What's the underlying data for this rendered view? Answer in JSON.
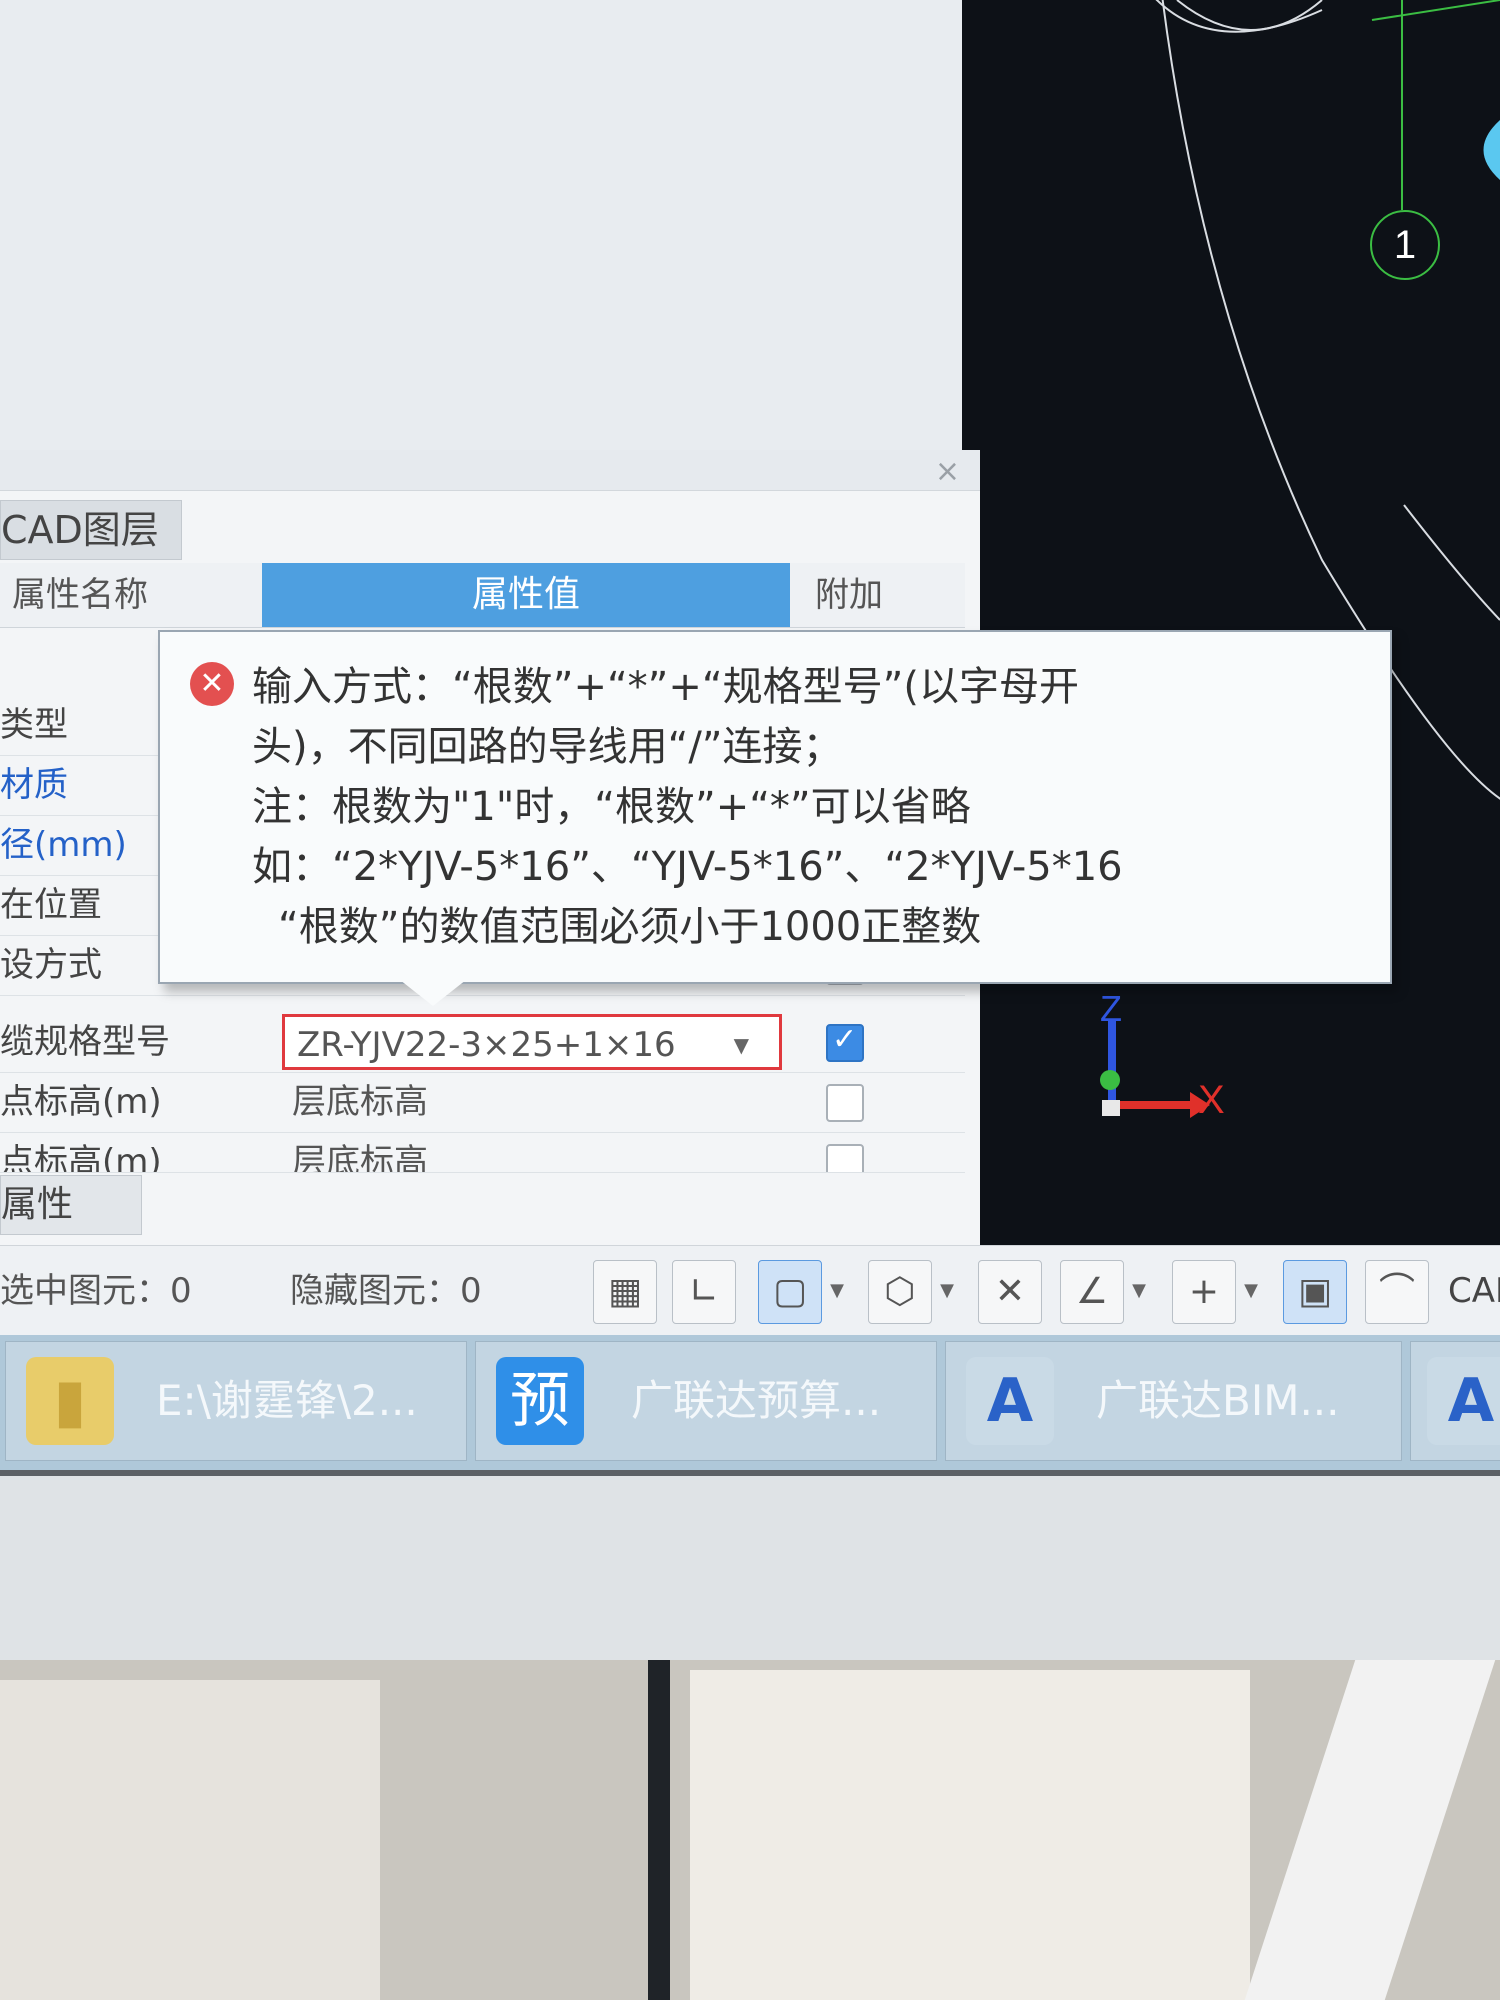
{
  "panel": {
    "close_glyph": "×",
    "tab_cad_layer": "CAD图层",
    "header": {
      "name": "属性名称",
      "value": "属性值",
      "extra": "附加"
    },
    "rows": [
      {
        "name": "类型",
        "value": ""
      },
      {
        "name": "材质",
        "value": ""
      },
      {
        "name": "径(mm)",
        "value": ""
      },
      {
        "name": "在位置",
        "value": ""
      },
      {
        "name": "设方式",
        "value": ""
      },
      {
        "name": "缆规格型号",
        "value": "ZR-YJV22-3×25+1×16"
      },
      {
        "name": "点标高(m)",
        "value": "层底标高"
      },
      {
        "name": "点标高(m)",
        "value": "层底标高"
      }
    ],
    "tab_props": "属性"
  },
  "tooltip": {
    "line1": "输入方式：“根数”+“*”+“规格型号”(以字母开",
    "line2": "头)，不同回路的导线用“/”连接；",
    "line3": "注：根数为\"1\"时，“根数”+“*”可以省略",
    "line4": "如：“2*YJV-5*16”、“YJV-5*16”、“2*YJV-5*16",
    "line5": "“根数”的数值范围必须小于1000正整数"
  },
  "status": {
    "selected": "选中图元：0",
    "hidden": "隐藏图元：0",
    "cad_label": "CAD"
  },
  "cad": {
    "axis_label": "1",
    "z_label": "Z",
    "x_label": "X"
  },
  "taskbar": [
    {
      "label": "E:\\谢霆锋\\2...",
      "icon": "folder-icon"
    },
    {
      "label": "广联达预算...",
      "icon": "budget-app-icon",
      "glyph": "预"
    },
    {
      "label": "广联达BIM...",
      "icon": "bim-app-icon",
      "glyph": "A"
    }
  ],
  "colors": {
    "header_accent": "#4e9fe0",
    "error_red": "#e35050",
    "input_border_error": "#e0393e",
    "cad_background": "#0d1117"
  }
}
